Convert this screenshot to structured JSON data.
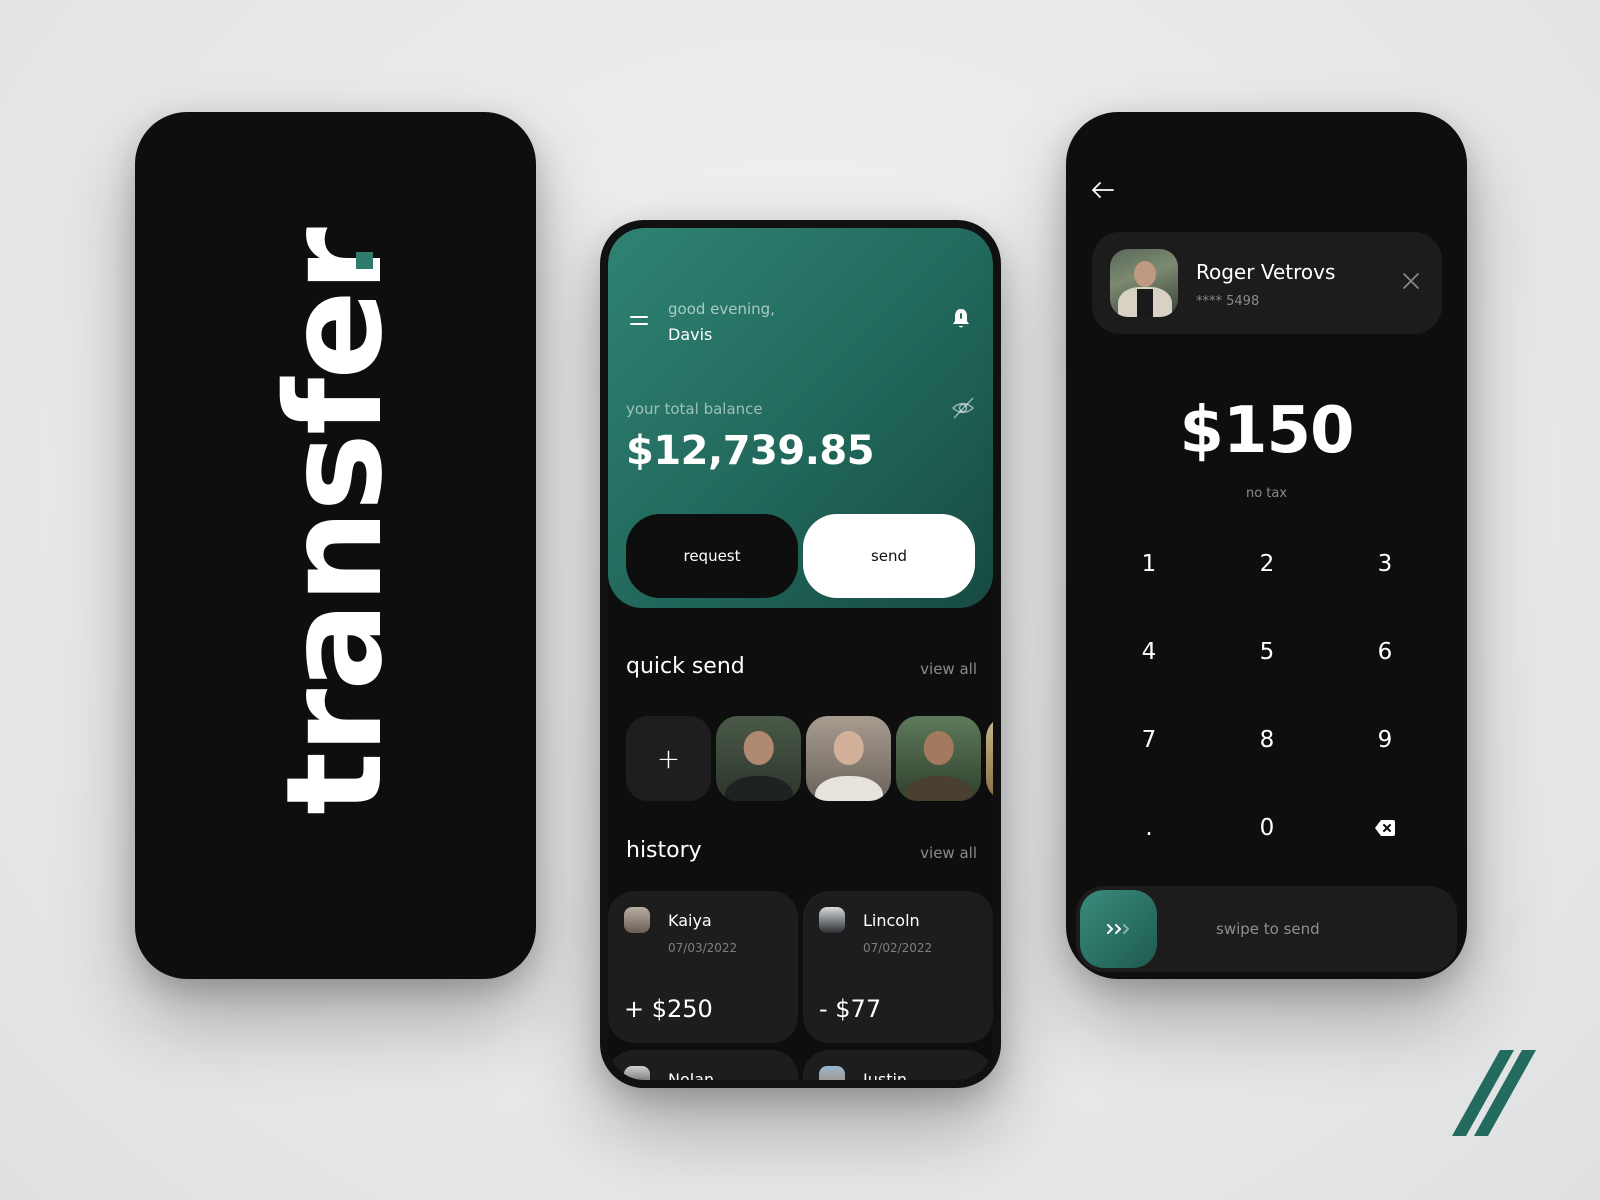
{
  "splash": {
    "wordmark": "transfer",
    "accent_color": "#2f7c6c"
  },
  "home": {
    "greeting": "good evening,",
    "user_name": "Davis",
    "balance_label": "your total balance",
    "balance_value": "$12,739.85",
    "request_label": "request",
    "send_label": "send",
    "quick_send": {
      "title": "quick send",
      "view_all": "view all",
      "add_symbol": "+",
      "contacts_count_visible": 4
    },
    "history": {
      "title": "history",
      "view_all": "view all",
      "items": [
        {
          "name": "Kaiya",
          "date": "07/03/2022",
          "amount": "+ $250"
        },
        {
          "name": "Lincoln",
          "date": "07/02/2022",
          "amount": "- $77"
        },
        {
          "name": "Nolan",
          "date": "",
          "amount": ""
        },
        {
          "name": "Justin",
          "date": "",
          "amount": ""
        }
      ]
    },
    "gradient_colors": [
      "#2f8373",
      "#174a42"
    ]
  },
  "send": {
    "recipient_name": "Roger Vetrovs",
    "recipient_card": "**** 5498",
    "amount": "$150",
    "tax_note": "no tax",
    "keys": [
      "1",
      "2",
      "3",
      "4",
      "5",
      "6",
      "7",
      "8",
      "9",
      ".",
      "0",
      "backspace"
    ],
    "swipe_label": "swipe to send"
  },
  "icons": {
    "menu": "menu-icon",
    "bell": "bell-icon",
    "eye_off": "eye-off-icon",
    "back": "arrow-left-icon",
    "close": "close-icon",
    "backspace": "backspace-icon",
    "chevrons": "chevrons-right-icon",
    "brand": "double-slash-logo"
  }
}
